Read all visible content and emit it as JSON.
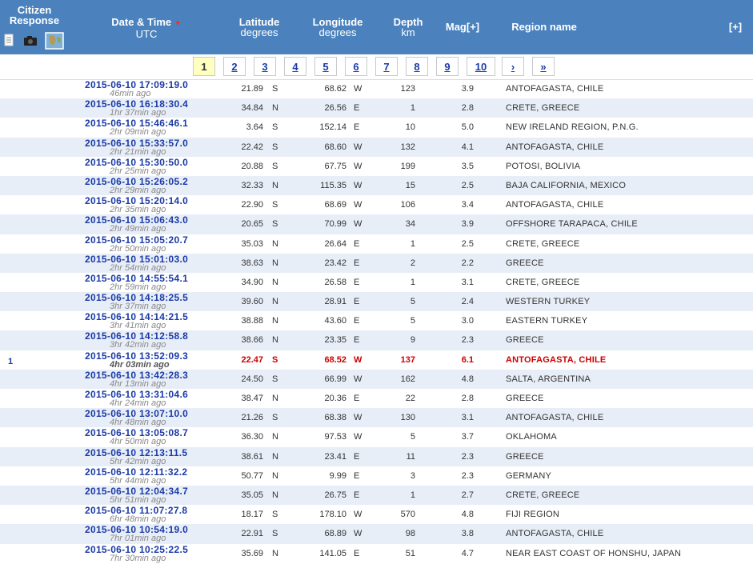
{
  "header": {
    "citizen_title": "Citizen",
    "citizen_title2": "Response",
    "date_title": "Date & Time",
    "date_sub": "UTC",
    "lat_title": "Latitude",
    "lat_sub": "degrees",
    "lon_title": "Longitude",
    "lon_sub": "degrees",
    "depth_title": "Depth",
    "depth_sub": "km",
    "mag_title": "Mag[+]",
    "region_title": "Region name",
    "expand": "[+]",
    "sort_arrow": "▼"
  },
  "pager": [
    "1",
    "2",
    "3",
    "4",
    "5",
    "6",
    "7",
    "8",
    "9",
    "10",
    "›",
    "»"
  ],
  "rows": [
    {
      "dt": "2015-06-10   17:09:19.0",
      "ago": "46min ago",
      "lat": "21.89",
      "ns": "S",
      "lon": "68.62",
      "ew": "W",
      "depth": "123",
      "mag": "3.9",
      "region": "ANTOFAGASTA, CHILE"
    },
    {
      "dt": "2015-06-10   16:18:30.4",
      "ago": "1hr 37min ago",
      "lat": "34.84",
      "ns": "N",
      "lon": "26.56",
      "ew": "E",
      "depth": "1",
      "mag": "2.8",
      "region": "CRETE, GREECE"
    },
    {
      "dt": "2015-06-10   15:46:46.1",
      "ago": "2hr 09min ago",
      "lat": "3.64",
      "ns": "S",
      "lon": "152.14",
      "ew": "E",
      "depth": "10",
      "mag": "5.0",
      "region": "NEW IRELAND REGION, P.N.G."
    },
    {
      "dt": "2015-06-10   15:33:57.0",
      "ago": "2hr 21min ago",
      "lat": "22.42",
      "ns": "S",
      "lon": "68.60",
      "ew": "W",
      "depth": "132",
      "mag": "4.1",
      "region": "ANTOFAGASTA, CHILE"
    },
    {
      "dt": "2015-06-10   15:30:50.0",
      "ago": "2hr 25min ago",
      "lat": "20.88",
      "ns": "S",
      "lon": "67.75",
      "ew": "W",
      "depth": "199",
      "mag": "3.5",
      "region": "POTOSI, BOLIVIA"
    },
    {
      "dt": "2015-06-10   15:26:05.2",
      "ago": "2hr 29min ago",
      "lat": "32.33",
      "ns": "N",
      "lon": "115.35",
      "ew": "W",
      "depth": "15",
      "mag": "2.5",
      "region": "BAJA CALIFORNIA, MEXICO"
    },
    {
      "dt": "2015-06-10   15:20:14.0",
      "ago": "2hr 35min ago",
      "lat": "22.90",
      "ns": "S",
      "lon": "68.69",
      "ew": "W",
      "depth": "106",
      "mag": "3.4",
      "region": "ANTOFAGASTA, CHILE"
    },
    {
      "dt": "2015-06-10   15:06:43.0",
      "ago": "2hr 49min ago",
      "lat": "20.65",
      "ns": "S",
      "lon": "70.99",
      "ew": "W",
      "depth": "34",
      "mag": "3.9",
      "region": "OFFSHORE TARAPACA, CHILE"
    },
    {
      "dt": "2015-06-10   15:05:20.7",
      "ago": "2hr 50min ago",
      "lat": "35.03",
      "ns": "N",
      "lon": "26.64",
      "ew": "E",
      "depth": "1",
      "mag": "2.5",
      "region": "CRETE, GREECE"
    },
    {
      "dt": "2015-06-10   15:01:03.0",
      "ago": "2hr 54min ago",
      "lat": "38.63",
      "ns": "N",
      "lon": "23.42",
      "ew": "E",
      "depth": "2",
      "mag": "2.2",
      "region": "GREECE"
    },
    {
      "dt": "2015-06-10   14:55:54.1",
      "ago": "2hr 59min ago",
      "lat": "34.90",
      "ns": "N",
      "lon": "26.58",
      "ew": "E",
      "depth": "1",
      "mag": "3.1",
      "region": "CRETE, GREECE"
    },
    {
      "dt": "2015-06-10   14:18:25.5",
      "ago": "3hr 37min ago",
      "lat": "39.60",
      "ns": "N",
      "lon": "28.91",
      "ew": "E",
      "depth": "5",
      "mag": "2.4",
      "region": "WESTERN TURKEY"
    },
    {
      "dt": "2015-06-10   14:14:21.5",
      "ago": "3hr 41min ago",
      "lat": "38.88",
      "ns": "N",
      "lon": "43.60",
      "ew": "E",
      "depth": "5",
      "mag": "3.0",
      "region": "EASTERN TURKEY"
    },
    {
      "dt": "2015-06-10   14:12:58.8",
      "ago": "3hr 42min ago",
      "lat": "38.66",
      "ns": "N",
      "lon": "23.35",
      "ew": "E",
      "depth": "9",
      "mag": "2.3",
      "region": "GREECE"
    },
    {
      "num": "1",
      "major": true,
      "dt": "2015-06-10   13:52:09.3",
      "ago": "4hr 03min ago",
      "lat": "22.47",
      "ns": "S",
      "lon": "68.52",
      "ew": "W",
      "depth": "137",
      "mag": "6.1",
      "region": "ANTOFAGASTA, CHILE"
    },
    {
      "dt": "2015-06-10   13:42:28.3",
      "ago": "4hr 13min ago",
      "lat": "24.50",
      "ns": "S",
      "lon": "66.99",
      "ew": "W",
      "depth": "162",
      "mag": "4.8",
      "region": "SALTA, ARGENTINA"
    },
    {
      "dt": "2015-06-10   13:31:04.6",
      "ago": "4hr 24min ago",
      "lat": "38.47",
      "ns": "N",
      "lon": "20.36",
      "ew": "E",
      "depth": "22",
      "mag": "2.8",
      "region": "GREECE"
    },
    {
      "dt": "2015-06-10   13:07:10.0",
      "ago": "4hr 48min ago",
      "lat": "21.26",
      "ns": "S",
      "lon": "68.38",
      "ew": "W",
      "depth": "130",
      "mag": "3.1",
      "region": "ANTOFAGASTA, CHILE"
    },
    {
      "dt": "2015-06-10   13:05:08.7",
      "ago": "4hr 50min ago",
      "lat": "36.30",
      "ns": "N",
      "lon": "97.53",
      "ew": "W",
      "depth": "5",
      "mag": "3.7",
      "region": "OKLAHOMA"
    },
    {
      "dt": "2015-06-10   12:13:11.5",
      "ago": "5hr 42min ago",
      "lat": "38.61",
      "ns": "N",
      "lon": "23.41",
      "ew": "E",
      "depth": "11",
      "mag": "2.3",
      "region": "GREECE"
    },
    {
      "dt": "2015-06-10   12:11:32.2",
      "ago": "5hr 44min ago",
      "lat": "50.77",
      "ns": "N",
      "lon": "9.99",
      "ew": "E",
      "depth": "3",
      "mag": "2.3",
      "region": "GERMANY"
    },
    {
      "dt": "2015-06-10   12:04:34.7",
      "ago": "5hr 51min ago",
      "lat": "35.05",
      "ns": "N",
      "lon": "26.75",
      "ew": "E",
      "depth": "1",
      "mag": "2.7",
      "region": "CRETE, GREECE"
    },
    {
      "dt": "2015-06-10   11:07:27.8",
      "ago": "6hr 48min ago",
      "lat": "18.17",
      "ns": "S",
      "lon": "178.10",
      "ew": "W",
      "depth": "570",
      "mag": "4.8",
      "region": "FIJI REGION"
    },
    {
      "dt": "2015-06-10   10:54:19.0",
      "ago": "7hr 01min ago",
      "lat": "22.91",
      "ns": "S",
      "lon": "68.89",
      "ew": "W",
      "depth": "98",
      "mag": "3.8",
      "region": "ANTOFAGASTA, CHILE"
    },
    {
      "dt": "2015-06-10   10:25:22.5",
      "ago": "7hr 30min ago",
      "lat": "35.69",
      "ns": "N",
      "lon": "141.05",
      "ew": "E",
      "depth": "51",
      "mag": "4.7",
      "region": "NEAR EAST COAST OF HONSHU, JAPAN"
    }
  ]
}
